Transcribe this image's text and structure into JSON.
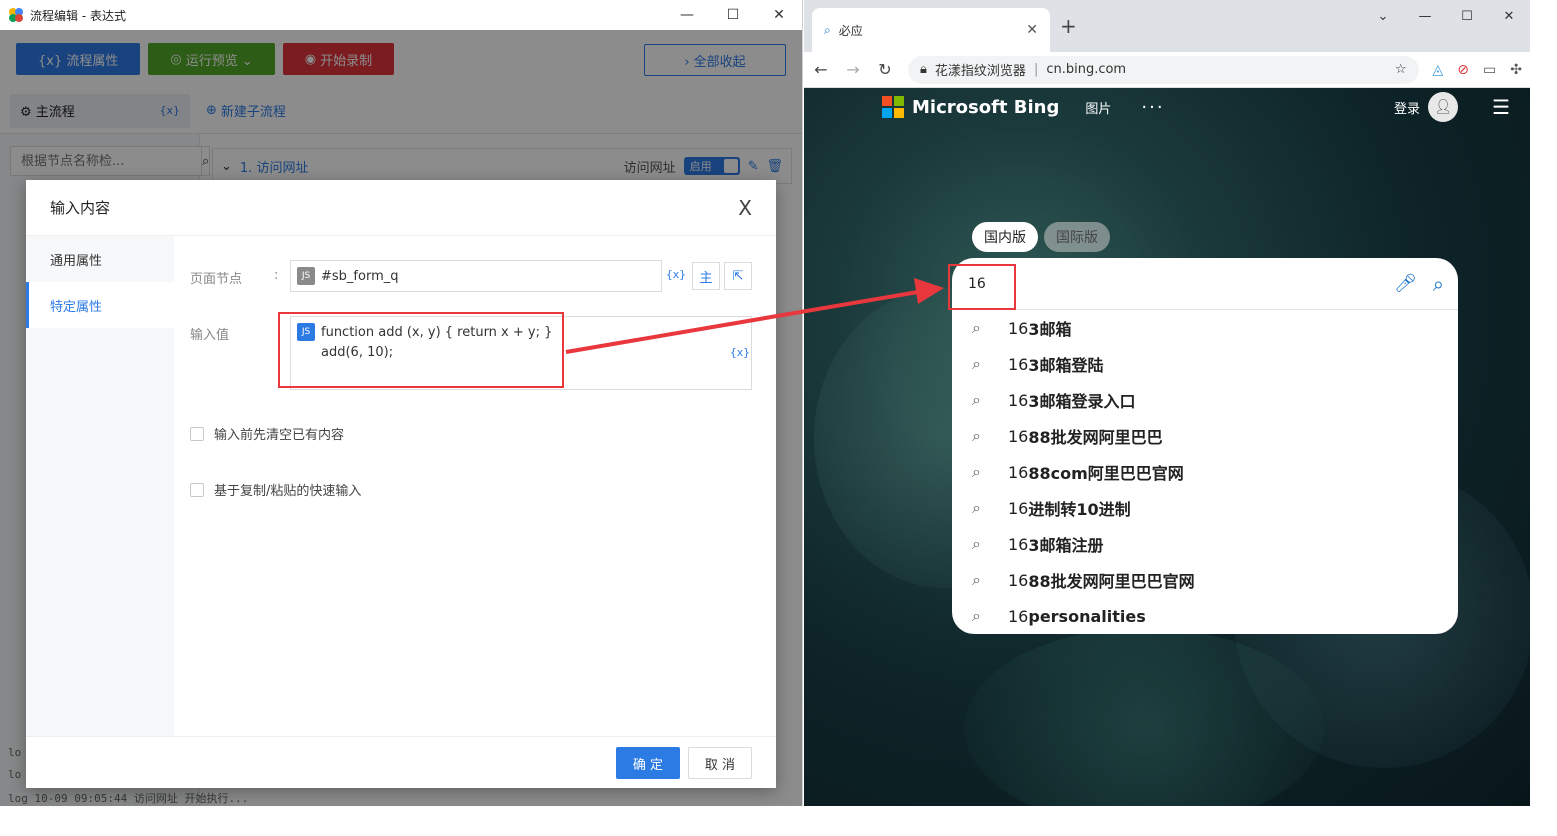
{
  "app": {
    "title": "流程编辑 - 表达式",
    "window_controls": {
      "minimize": "—",
      "maximize": "☐",
      "close": "✕"
    },
    "toolbar": {
      "flow_props": "{x} 流程属性",
      "run_preview": "运行预览 ⌄",
      "start_record": "开始录制",
      "collapse_all": "› 全部收起"
    },
    "tabs": {
      "main_flow": "主流程",
      "main_flow_var": "{x}",
      "new_subflow": "新建子流程"
    },
    "search_placeholder": "根据节点名称检...",
    "node": {
      "index_title": "1. 访问网址",
      "type": "访问网址",
      "enabled": "启用"
    },
    "log_lines": [
      "lo",
      "lo",
      "log 10-09 09:05:44 访问网址 开始执行..."
    ]
  },
  "dialog": {
    "title": "输入内容",
    "close": "X",
    "side_items": [
      "通用属性",
      "特定属性"
    ],
    "page_node_label": "页面节点",
    "colon": ":",
    "page_node_value": "#sb_form_q",
    "js_badge": "JS",
    "var_btn": "{x}",
    "main_btn": "主",
    "input_value_label": "输入值",
    "code_line1": "function add (x, y)  {  return x + y; }",
    "code_line2": "add(6, 10);",
    "clear_before": "输入前先清空已有内容",
    "paste_input": "基于复制/粘贴的快速输入",
    "ok": "确 定",
    "cancel": "取 消"
  },
  "browser": {
    "tab_title": "必应",
    "tab_close": "✕",
    "new_tab": "+",
    "window_controls": {
      "dropdown": "⌄",
      "minimize": "—",
      "maximize": "☐",
      "close": "✕"
    },
    "site_name": "花漾指纹浏览器",
    "url": "cn.bing.com",
    "brand": "Microsoft Bing",
    "nav_images": "图片",
    "nav_more": "···",
    "login": "登录",
    "region_cn": "国内版",
    "region_intl": "国际版",
    "search_value": "16",
    "suggestions": [
      {
        "prefix": "16",
        "bold": "3邮箱"
      },
      {
        "prefix": "16",
        "bold": "3邮箱登陆"
      },
      {
        "prefix": "16",
        "bold": "3邮箱登录入口"
      },
      {
        "prefix": "16",
        "bold": "88批发网阿里巴巴"
      },
      {
        "prefix": "16",
        "bold": "88com阿里巴巴官网"
      },
      {
        "prefix": "16",
        "bold": "进制转10进制"
      },
      {
        "prefix": "16",
        "bold": "3邮箱注册"
      },
      {
        "prefix": "16",
        "bold": "88批发网阿里巴巴官网"
      },
      {
        "prefix": "16 ",
        "bold": "personalities"
      }
    ]
  },
  "colors": {
    "accent": "#2c7be5",
    "annotation": "#e8373d",
    "ok_green": "#52a829",
    "record_red": "#e0343b"
  }
}
